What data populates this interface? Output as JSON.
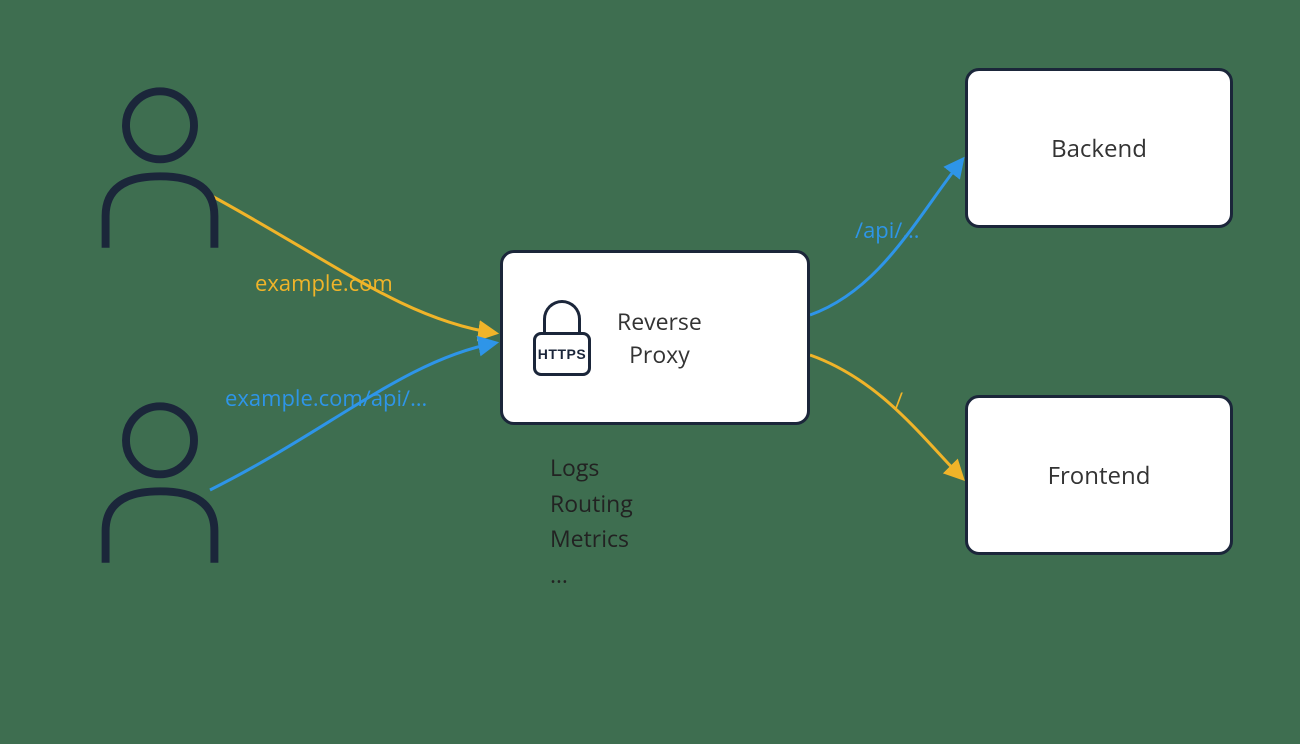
{
  "nodes": {
    "proxy": {
      "line1": "Reverse",
      "line2": "Proxy",
      "https_badge": "HTTPS"
    },
    "backend": {
      "label": "Backend"
    },
    "frontend": {
      "label": "Frontend"
    }
  },
  "edges": {
    "user1_to_proxy": {
      "label": "example.com",
      "color": "#f0b429"
    },
    "user2_to_proxy": {
      "label": "example.com/api/…",
      "color": "#2e95e8"
    },
    "proxy_to_backend": {
      "label": "/api/…",
      "color": "#2e95e8"
    },
    "proxy_to_frontend": {
      "label": "/",
      "color": "#f0b429"
    }
  },
  "features": {
    "line1": "Logs",
    "line2": "Routing",
    "line3": "Metrics",
    "line4": "…"
  },
  "colors": {
    "bg": "#3e6e50",
    "outline": "#1b263a",
    "yellow": "#f0b429",
    "blue": "#2e95e8"
  }
}
